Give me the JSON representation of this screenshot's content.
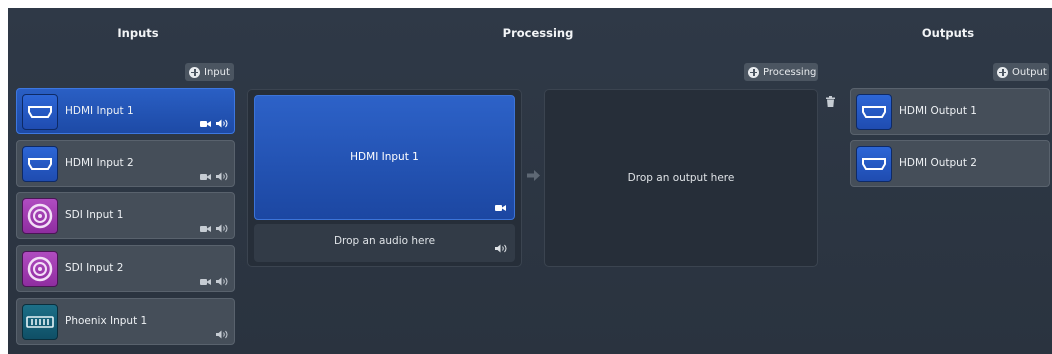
{
  "columns": {
    "inputs_title": "Inputs",
    "processing_title": "Processing",
    "outputs_title": "Outputs"
  },
  "buttons": {
    "add_input": "Input",
    "add_processing": "Processing",
    "add_output": "Output"
  },
  "inputs": [
    {
      "label": "HDMI Input 1",
      "type": "hdmi",
      "active": true
    },
    {
      "label": "HDMI Input 2",
      "type": "hdmi",
      "active": false
    },
    {
      "label": "SDI Input 1",
      "type": "sdi",
      "active": false
    },
    {
      "label": "SDI Input 2",
      "type": "sdi",
      "active": false
    },
    {
      "label": "Phoenix Input 1",
      "type": "phoenix",
      "active": false
    }
  ],
  "processing": {
    "video_source": "HDMI Input 1",
    "audio_placeholder": "Drop an audio here",
    "output_placeholder": "Drop an output here"
  },
  "outputs": [
    {
      "label": "HDMI Output 1",
      "type": "hdmi"
    },
    {
      "label": "HDMI Output 2",
      "type": "hdmi"
    }
  ],
  "colors": {
    "background": "#2c3542",
    "card": "#454e59",
    "active_blue": "#2a5fc4",
    "hdmi_icon": "#2d66d6",
    "sdi_icon": "#b04cc0",
    "phoenix_icon": "#1c6f88"
  },
  "icons": [
    "plus-icon",
    "hdmi-port-icon",
    "sdi-port-icon",
    "phoenix-connector-icon",
    "video-camera-icon",
    "speaker-icon",
    "arrow-right-icon",
    "trash-icon"
  ]
}
